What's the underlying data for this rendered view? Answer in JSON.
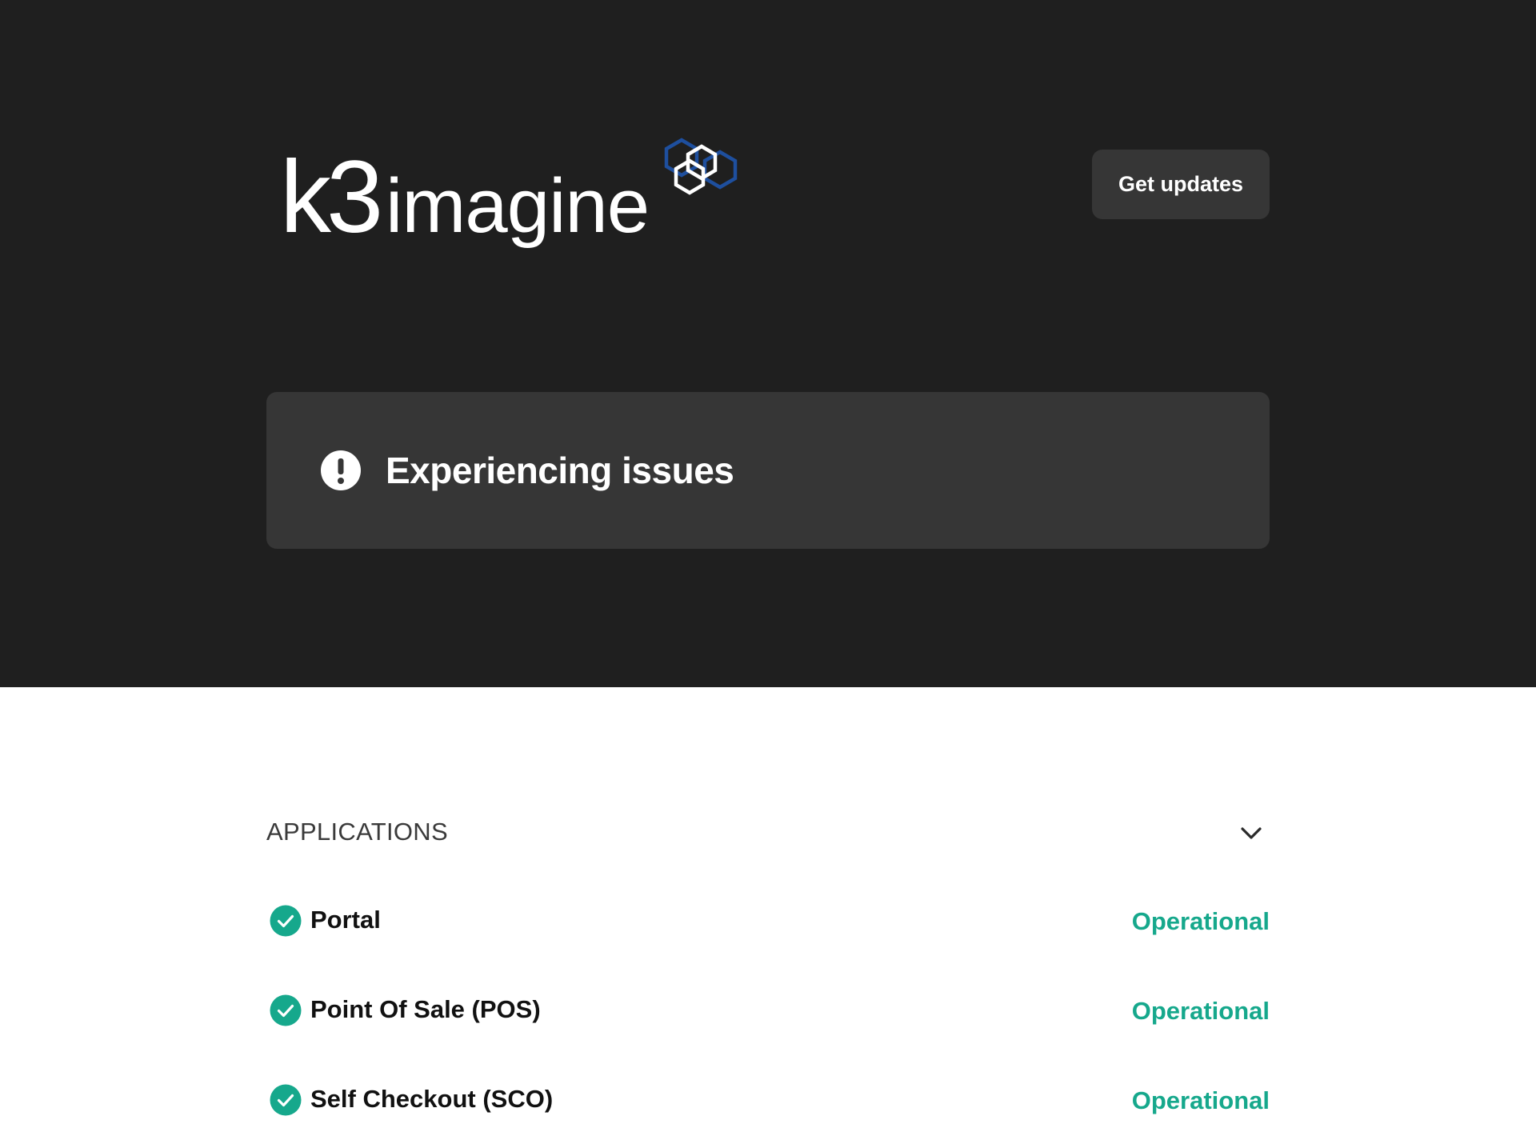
{
  "header": {
    "logo_text": "k3imagine",
    "get_updates_label": "Get updates"
  },
  "status": {
    "text": "Experiencing issues",
    "icon": "exclamation-circle-icon"
  },
  "colors": {
    "hero_bg": "#1f1f1f",
    "card_bg": "#363636",
    "operational": "#16a88c",
    "logo_blue": "#1e4f9e"
  },
  "group": {
    "title": "APPLICATIONS",
    "expand_icon": "chevron-down-icon",
    "components": [
      {
        "name": "Portal",
        "status": "Operational"
      },
      {
        "name": "Point Of Sale (POS)",
        "status": "Operational"
      },
      {
        "name": "Self Checkout (SCO)",
        "status": "Operational"
      }
    ]
  }
}
